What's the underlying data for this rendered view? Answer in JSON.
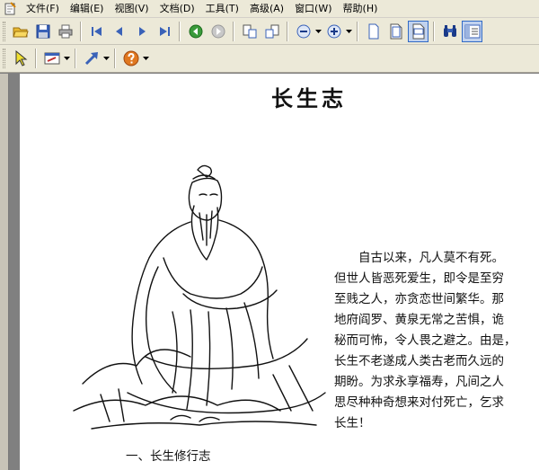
{
  "menu": {
    "items": [
      {
        "name": "menu-file",
        "label": "文件(F)"
      },
      {
        "name": "menu-edit",
        "label": "编辑(E)"
      },
      {
        "name": "menu-view",
        "label": "视图(V)"
      },
      {
        "name": "menu-document",
        "label": "文档(D)"
      },
      {
        "name": "menu-tools",
        "label": "工具(T)"
      },
      {
        "name": "menu-advanced",
        "label": "高级(A)"
      },
      {
        "name": "menu-window",
        "label": "窗口(W)"
      },
      {
        "name": "menu-help",
        "label": "帮助(H)"
      }
    ]
  },
  "toolbar_icons": {
    "open": "folder-open-icon",
    "save": "save-icon",
    "print": "print-icon",
    "first_page": "first-page-icon",
    "prev_page": "previous-page-icon",
    "next_page": "next-page-icon",
    "last_page": "last-page-icon",
    "back": "go-back-icon",
    "forward": "go-forward-icon",
    "rotate_cw": "rotate-clockwise-icon",
    "rotate_ccw": "rotate-counterclockwise-icon",
    "zoom_out": "zoom-out-icon",
    "zoom_in": "zoom-in-icon",
    "single_page": "single-page-icon",
    "fit_page": "fit-page-icon",
    "fit_width": "fit-width-icon",
    "find": "binoculars-icon",
    "thumbnails": "thumbnails-icon",
    "select": "select-arrow-icon",
    "annotation": "annotation-icon",
    "link": "link-arrow-icon",
    "help": "help-icon"
  },
  "document": {
    "title": "长生志",
    "body_lines": [
      "　　自古以来，凡人莫不有死。",
      "但世人皆恶死爱生，即令是至穷",
      "至贱之人，亦贪恋世间繁华。那",
      "地府阎罗、黄泉无常之苦惧，诡",
      "秘而可怖，令人畏之避之。由是，",
      "长生不老遂成人类古老而久远的",
      "期盼。为求永享福寿，凡间之人",
      "思尽种种奇想来对付死亡，乞求",
      "长生！"
    ],
    "section_heading": "一、长生修行志"
  },
  "colors": {
    "chrome": "#ece9d8",
    "accent": "#316ac5",
    "canvas": "#808080"
  }
}
